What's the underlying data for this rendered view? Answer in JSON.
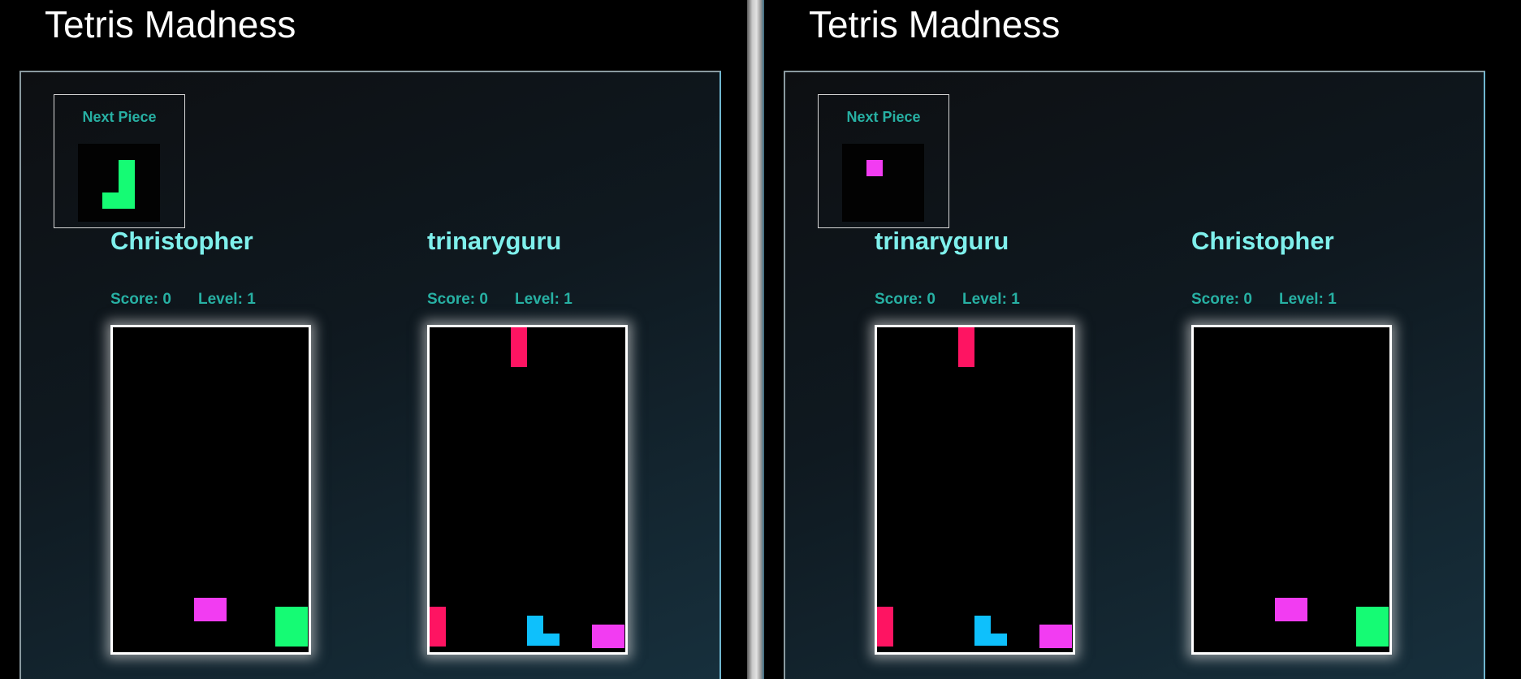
{
  "windows": [
    {
      "app_title": "Tetris Madness",
      "next_piece": {
        "label": "Next Piece",
        "cells": [
          {
            "c": 2,
            "r": 1,
            "color": "#15fb74"
          },
          {
            "c": 2,
            "r": 2,
            "color": "#15fb74"
          },
          {
            "c": 1,
            "r": 3,
            "color": "#15fb74"
          },
          {
            "c": 2,
            "r": 3,
            "color": "#15fb74"
          }
        ]
      },
      "players": [
        {
          "name": "Christopher",
          "score_text": "Score: 0",
          "level_text": "Level: 1",
          "cells": [
            {
              "c": 2.5,
              "r": 15,
              "w": 1,
              "h": 1,
              "color": "#f23cf2"
            },
            {
              "c": 5,
              "r": 15.5,
              "w": 1,
              "h": 2,
              "color": "#15fb74"
            }
          ]
        },
        {
          "name": "trinaryguru",
          "score_text": "Score: 0",
          "level_text": "Level: 1",
          "cells": [
            {
              "c": 2.5,
              "r": 0,
              "w": 0.5,
              "h": 2,
              "color": "#fe1462"
            },
            {
              "c": 0,
              "r": 15.5,
              "w": 0.5,
              "h": 2,
              "color": "#fe1462"
            },
            {
              "c": 3,
              "r": 16,
              "w": 0.5,
              "h": 1.5,
              "color": "#0ec0fc"
            },
            {
              "c": 3.5,
              "r": 17,
              "w": 0.5,
              "h": 0.5,
              "color": "#0ec0fc"
            },
            {
              "c": 5,
              "r": 16.5,
              "w": 1,
              "h": 1,
              "color": "#f23cf2"
            }
          ]
        }
      ]
    },
    {
      "app_title": "Tetris Madness",
      "next_piece": {
        "label": "Next Piece",
        "cells": [
          {
            "c": 1,
            "r": 1,
            "color": "#f23cf2"
          }
        ]
      },
      "players": [
        {
          "name": "trinaryguru",
          "score_text": "Score: 0",
          "level_text": "Level: 1",
          "cells": [
            {
              "c": 2.5,
              "r": 0,
              "w": 0.5,
              "h": 2,
              "color": "#fe1462"
            },
            {
              "c": 0,
              "r": 15.5,
              "w": 0.5,
              "h": 2,
              "color": "#fe1462"
            },
            {
              "c": 3,
              "r": 16,
              "w": 0.5,
              "h": 1.5,
              "color": "#0ec0fc"
            },
            {
              "c": 3.5,
              "r": 17,
              "w": 0.5,
              "h": 0.5,
              "color": "#0ec0fc"
            },
            {
              "c": 5,
              "r": 16.5,
              "w": 1,
              "h": 1,
              "color": "#f23cf2"
            }
          ]
        },
        {
          "name": "Christopher",
          "score_text": "Score: 0",
          "level_text": "Level: 1",
          "cells": [
            {
              "c": 2.5,
              "r": 15,
              "w": 1,
              "h": 1,
              "color": "#f23cf2"
            },
            {
              "c": 5,
              "r": 15.5,
              "w": 1,
              "h": 2,
              "color": "#15fb74"
            }
          ]
        }
      ]
    }
  ]
}
